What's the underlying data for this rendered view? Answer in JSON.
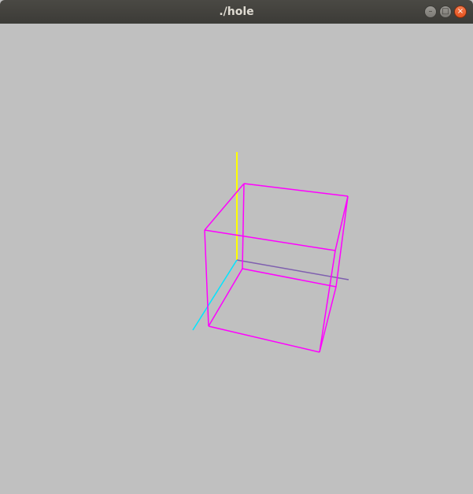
{
  "window": {
    "title": "./hole"
  },
  "controls": {
    "minimize_glyph": "–",
    "maximize_glyph": "□",
    "close_glyph": "×"
  },
  "colors": {
    "background": "#c0c0c0",
    "cube": "#ff00ff",
    "axis_y": "#ffff00",
    "axis_x": "#7f5faf",
    "axis_z": "#00e5ff"
  }
}
